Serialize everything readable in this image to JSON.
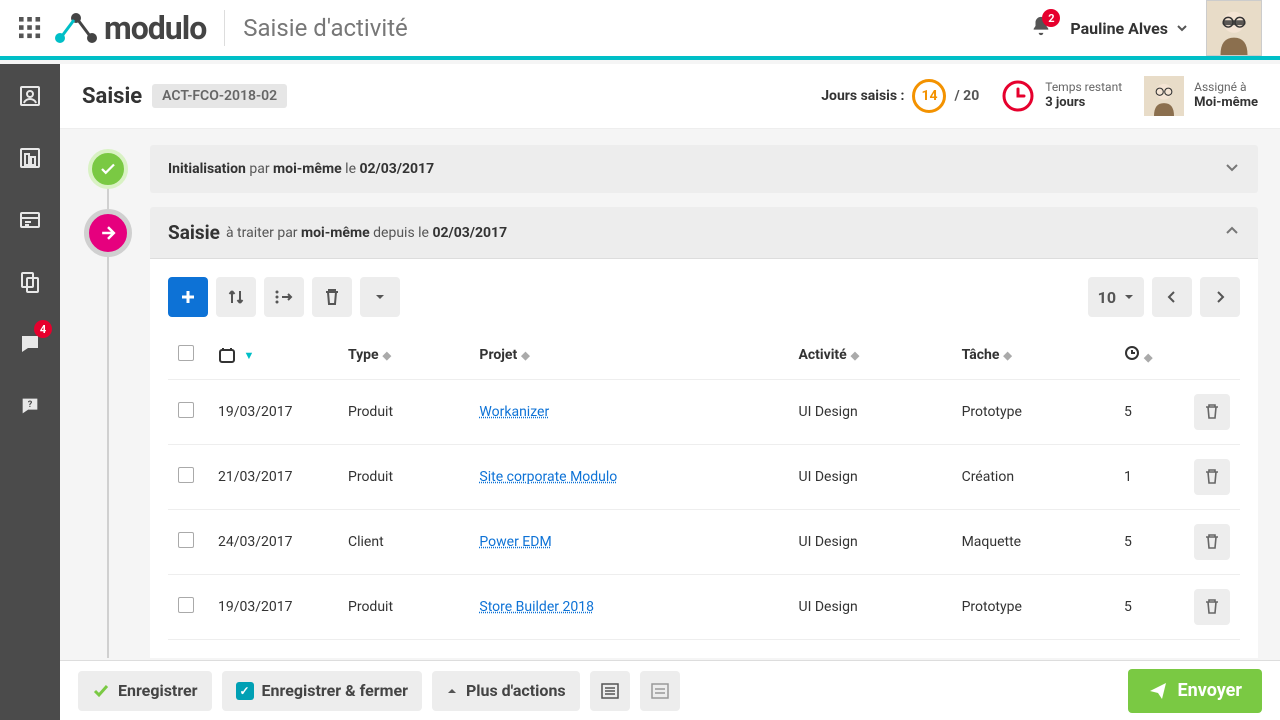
{
  "header": {
    "brand": "modulo",
    "page_title": "Saisie d'activité",
    "bell_count": "2",
    "user_name": "Pauline Alves"
  },
  "rail": {
    "chat_badge": "4"
  },
  "title": {
    "label": "Saisie",
    "code": "ACT-FCO-2018-02",
    "jours_label": "Jours saisis :",
    "jours_val": "14",
    "jours_max": "/ 20",
    "time_label": "Temps restant",
    "time_val": "3 jours",
    "assigned_label": "Assigné à",
    "assigned_val": "Moi-même"
  },
  "steps": {
    "init_prefix": "Initialisation",
    "init_by": " par ",
    "init_who": "moi-même",
    "init_on": " le ",
    "init_date": "02/03/2017",
    "saisie_title": "Saisie",
    "saisie_mid": " à traiter par ",
    "saisie_who": "moi-même",
    "saisie_since": " depuis le ",
    "saisie_date": "02/03/2017"
  },
  "toolbar": {
    "page_size": "10"
  },
  "columns": {
    "type": "Type",
    "projet": "Projet",
    "activite": "Activité",
    "tache": "Tâche"
  },
  "rows": [
    {
      "date": "19/03/2017",
      "type": "Produit",
      "projet": "Workanizer",
      "activite": "UI Design",
      "tache": "Prototype",
      "duree": "5"
    },
    {
      "date": "21/03/2017",
      "type": "Produit",
      "projet": "Site corporate Modulo",
      "activite": "UI Design",
      "tache": "Création",
      "duree": "1"
    },
    {
      "date": "24/03/2017",
      "type": "Client",
      "projet": "Power EDM",
      "activite": "UI Design",
      "tache": "Maquette",
      "duree": "5"
    },
    {
      "date": "19/03/2017",
      "type": "Produit",
      "projet": "Store Builder 2018",
      "activite": "UI Design",
      "tache": "Prototype",
      "duree": "5"
    }
  ],
  "footer": {
    "save": "Enregistrer",
    "save_close": "Enregistrer & fermer",
    "more": "Plus d'actions",
    "send": "Envoyer"
  }
}
